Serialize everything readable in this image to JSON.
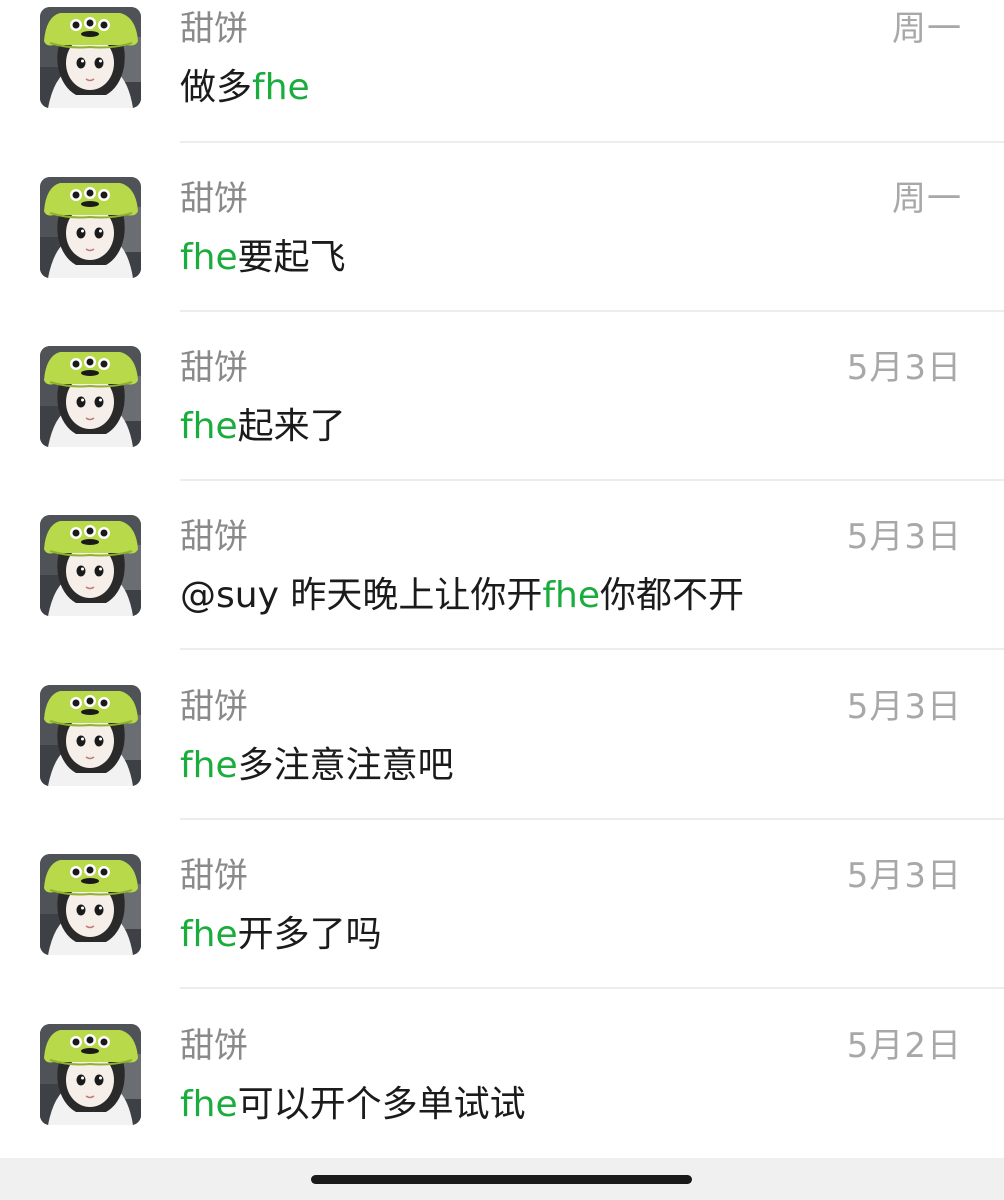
{
  "messages": [
    {
      "sender": "甜饼",
      "date": "周一",
      "text": [
        {
          "t": "做多"
        },
        {
          "t": "fhe",
          "hl": true
        }
      ]
    },
    {
      "sender": "甜饼",
      "date": "周一",
      "text": [
        {
          "t": "fhe",
          "hl": true
        },
        {
          "t": "要起飞"
        }
      ]
    },
    {
      "sender": "甜饼",
      "date": "5月3日",
      "text": [
        {
          "t": "fhe",
          "hl": true
        },
        {
          "t": "起来了"
        }
      ]
    },
    {
      "sender": "甜饼",
      "date": "5月3日",
      "text": [
        {
          "t": "@suy 昨天晚上让你开"
        },
        {
          "t": "fhe",
          "hl": true
        },
        {
          "t": "你都不开"
        }
      ]
    },
    {
      "sender": "甜饼",
      "date": "5月3日",
      "text": [
        {
          "t": "fhe",
          "hl": true
        },
        {
          "t": "多注意注意吧"
        }
      ]
    },
    {
      "sender": "甜饼",
      "date": "5月3日",
      "text": [
        {
          "t": "fhe",
          "hl": true
        },
        {
          "t": "开多了吗"
        }
      ]
    },
    {
      "sender": "甜饼",
      "date": "5月2日",
      "text": [
        {
          "t": "fhe",
          "hl": true
        },
        {
          "t": "可以开个多单试试"
        }
      ]
    }
  ],
  "colors": {
    "highlight": "#1aad3d",
    "sender": "#8a8a8a",
    "date": "#a8a8a8",
    "message": "#1b1b1b"
  },
  "icons": {
    "avatar": "cartoon-girl-alien-hat-avatar"
  }
}
